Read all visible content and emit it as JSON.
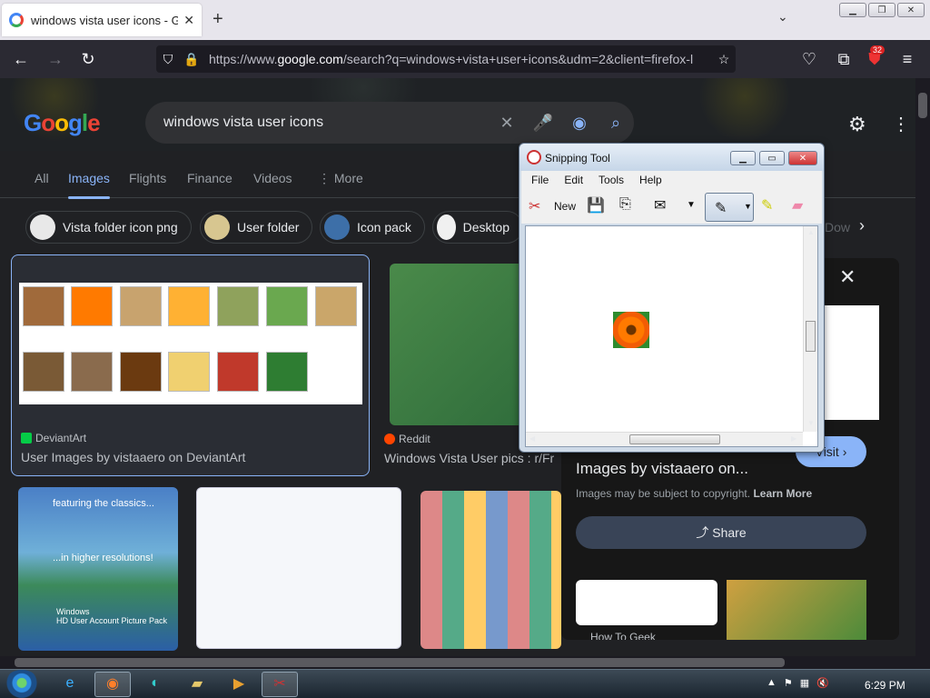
{
  "browser": {
    "tab_title": "windows vista user icons - Goo",
    "new_tab_symbol": "+",
    "url_prefix": "https://www.",
    "url_domain": "google.com",
    "url_rest": "/search?q=windows+vista+user+icons&udm=2&client=firefox-l",
    "extension_badge": "32"
  },
  "google": {
    "logo": "Google",
    "query": "windows vista user icons",
    "filters": [
      "All",
      "Images",
      "Flights",
      "Finance",
      "Videos",
      "More"
    ],
    "chips": [
      "Vista folder icon png",
      "User folder",
      "Icon pack",
      "Desktop",
      "Dow"
    ],
    "results": [
      {
        "source": "DeviantArt",
        "title": "User Images by vistaaero on DeviantArt"
      },
      {
        "source": "Reddit",
        "title": "Windows Vista User pics : r/Fr"
      }
    ],
    "thumb_texts": [
      "featuring the classics...",
      "...in higher resolutions!",
      "Windows",
      "HD User Account Picture Pack"
    ]
  },
  "panel": {
    "title": "Images by vistaaero on...",
    "copyright": "Images may be subject to copyright.",
    "learn_more": "Learn More",
    "share": "Share",
    "visit": "Visit",
    "related_caption": "How To Geek"
  },
  "snipping_tool": {
    "title": "Snipping Tool",
    "menu": [
      "File",
      "Edit",
      "Tools",
      "Help"
    ],
    "new_label": "New"
  },
  "taskbar": {
    "clock": "6:29 PM"
  },
  "colors": {
    "accent": "#8ab4f8",
    "page_bg": "#202124",
    "chrome_bg": "#2b2a33"
  }
}
